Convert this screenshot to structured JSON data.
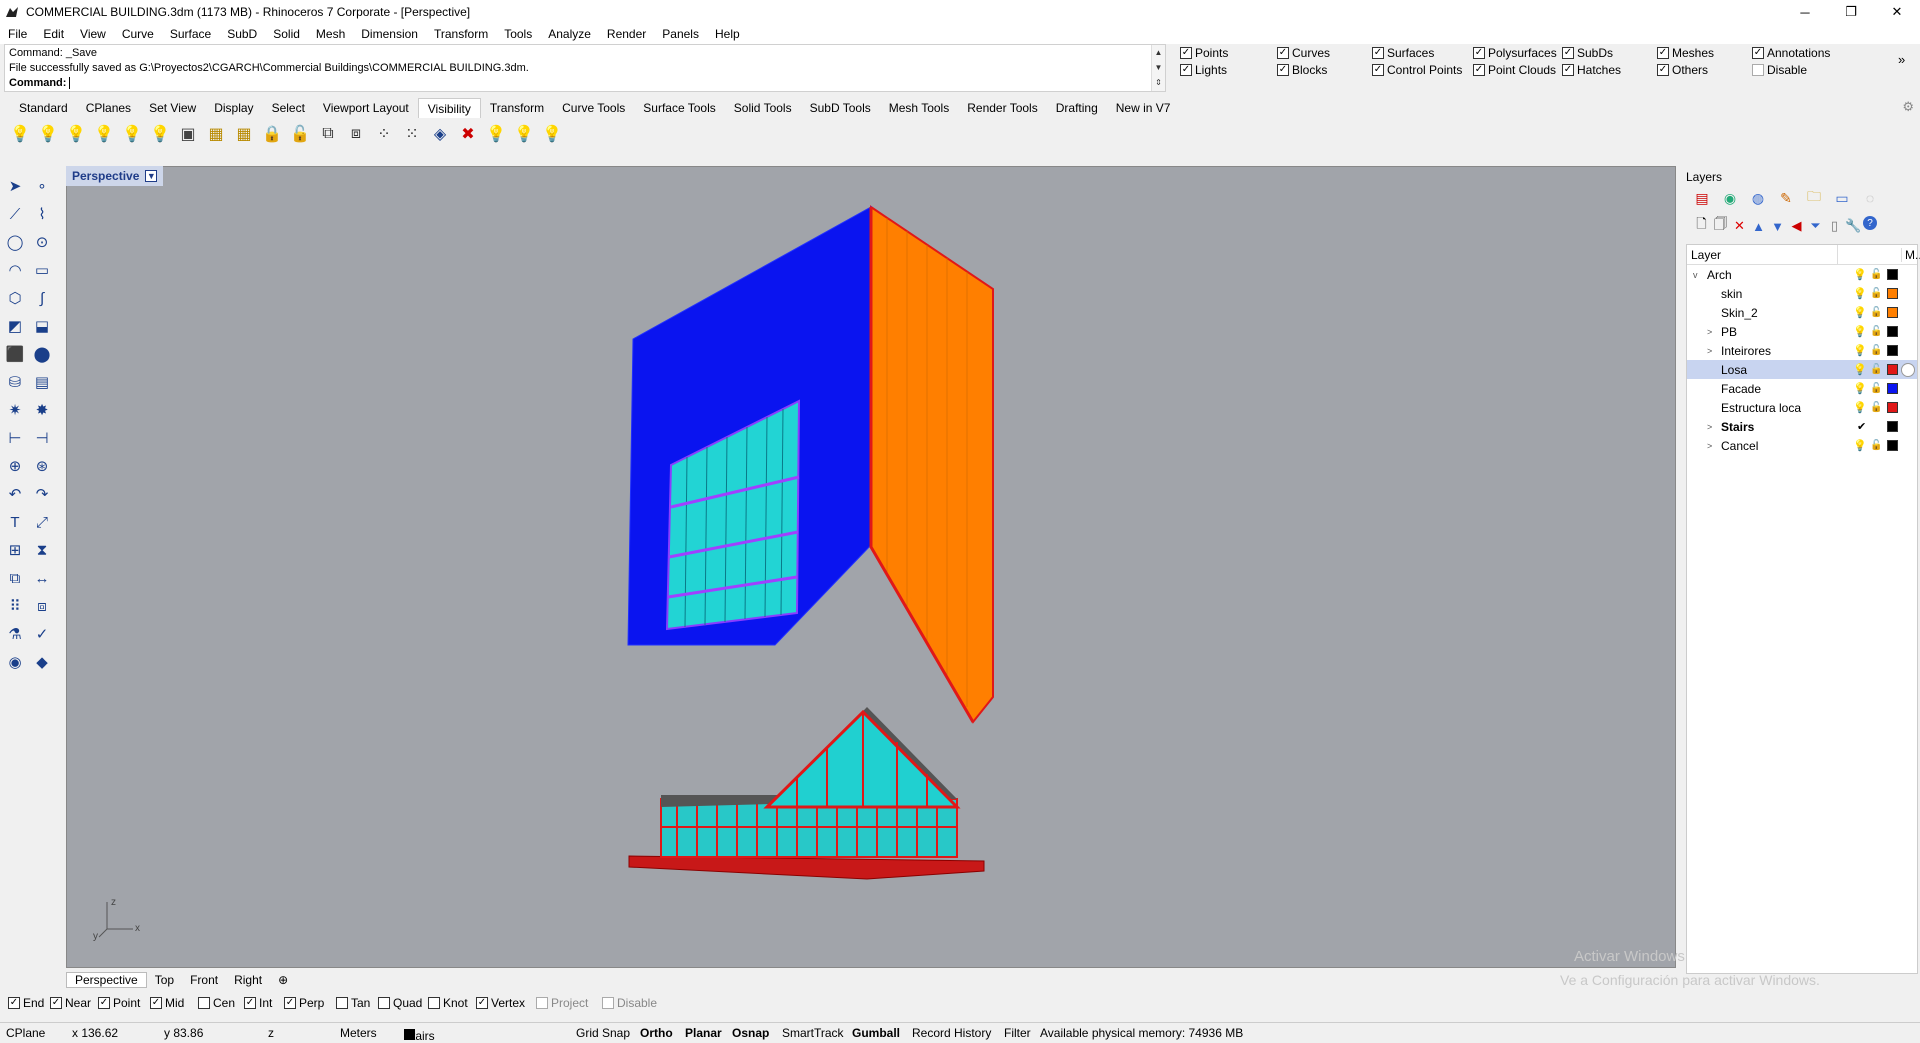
{
  "window": {
    "title": "COMMERCIAL BUILDING.3dm (1173 MB) - Rhinoceros 7 Corporate - [Perspective]",
    "minimize": "─",
    "maximize": "❐",
    "close": "✕"
  },
  "menu": [
    "File",
    "Edit",
    "View",
    "Curve",
    "Surface",
    "SubD",
    "Solid",
    "Mesh",
    "Dimension",
    "Transform",
    "Tools",
    "Analyze",
    "Render",
    "Panels",
    "Help"
  ],
  "command": {
    "history1": "Command: _Save",
    "history2": "File successfully saved as G:\\Proyectos2\\CGARCH\\Commercial Buildings\\COMMERCIAL BUILDING.3dm.",
    "prompt": "Command:",
    "input": ""
  },
  "filters": {
    "points": "Points",
    "curves": "Curves",
    "surfaces": "Surfaces",
    "polysurfaces": "Polysurfaces",
    "subds": "SubDs",
    "meshes": "Meshes",
    "annotations": "Annotations",
    "lights": "Lights",
    "blocks": "Blocks",
    "control_points": "Control Points",
    "point_clouds": "Point Clouds",
    "hatches": "Hatches",
    "others": "Others",
    "disable": "Disable",
    "more": "»"
  },
  "tabs": [
    "Standard",
    "CPlanes",
    "Set View",
    "Display",
    "Select",
    "Viewport Layout",
    "Visibility",
    "Transform",
    "Curve Tools",
    "Surface Tools",
    "Solid Tools",
    "SubD Tools",
    "Mesh Tools",
    "Render Tools",
    "Drafting",
    "New in V7"
  ],
  "active_tab": "Visibility",
  "viewport": {
    "name": "Perspective",
    "axis_z": "z",
    "axis_x": "x",
    "axis_y": "y",
    "colors": {
      "background": "#a1a4aa",
      "facade": "#0a14f0",
      "skin": "#ff7f00",
      "glass": "#20d5d0",
      "structure": "#e01818"
    }
  },
  "viewport_tabs": [
    "Perspective",
    "Top",
    "Front",
    "Right",
    "⊕"
  ],
  "layers": {
    "panel_title": "Layers",
    "column_layer": "Layer",
    "column_m": "M...",
    "rows": [
      {
        "name": "Arch",
        "color": "#000000",
        "expand": "v",
        "indent": 0
      },
      {
        "name": "skin",
        "color": "#ff7f00",
        "expand": "",
        "indent": 1
      },
      {
        "name": "Skin_2",
        "color": "#ff7f00",
        "expand": "",
        "indent": 1
      },
      {
        "name": "PB",
        "color": "#000000",
        "expand": ">",
        "indent": 1
      },
      {
        "name": "Inteirores",
        "color": "#000000",
        "expand": ">",
        "indent": 1
      },
      {
        "name": "Losa",
        "color": "#e01818",
        "expand": "",
        "indent": 1,
        "selected": true
      },
      {
        "name": "Facade",
        "color": "#0a14f0",
        "expand": "",
        "indent": 1
      },
      {
        "name": "Estructura loca",
        "color": "#e01818",
        "expand": "",
        "indent": 1
      },
      {
        "name": "Stairs",
        "color": "#000000",
        "expand": ">",
        "indent": 1,
        "current": true
      },
      {
        "name": "Cancel",
        "color": "#000000",
        "expand": ">",
        "indent": 1
      }
    ],
    "current_mark": "✔"
  },
  "osnaps": [
    {
      "label": "End",
      "checked": true
    },
    {
      "label": "Near",
      "checked": true
    },
    {
      "label": "Point",
      "checked": true
    },
    {
      "label": "Mid",
      "checked": true
    },
    {
      "label": "Cen",
      "checked": false
    },
    {
      "label": "Int",
      "checked": true
    },
    {
      "label": "Perp",
      "checked": true
    },
    {
      "label": "Tan",
      "checked": false
    },
    {
      "label": "Quad",
      "checked": false
    },
    {
      "label": "Knot",
      "checked": false
    },
    {
      "label": "Vertex",
      "checked": true
    },
    {
      "label": "Project",
      "checked": false,
      "disabled": true
    },
    {
      "label": "Disable",
      "checked": false,
      "disabled": true
    }
  ],
  "status": {
    "cplane": "CPlane",
    "x": "x 136.62",
    "y": "y 83.86",
    "z": "z",
    "units": "Meters",
    "layer": "Stairs",
    "grid_snap": "Grid Snap",
    "ortho": "Ortho",
    "planar": "Planar",
    "osnap": "Osnap",
    "smarttrack": "SmartTrack",
    "gumball": "Gumball",
    "record_history": "Record History",
    "filter": "Filter",
    "memory": "Available physical memory: 74936 MB"
  },
  "watermark": {
    "line1": "Activar Windows",
    "line2": "Ve a Configuración para activar Windows."
  }
}
